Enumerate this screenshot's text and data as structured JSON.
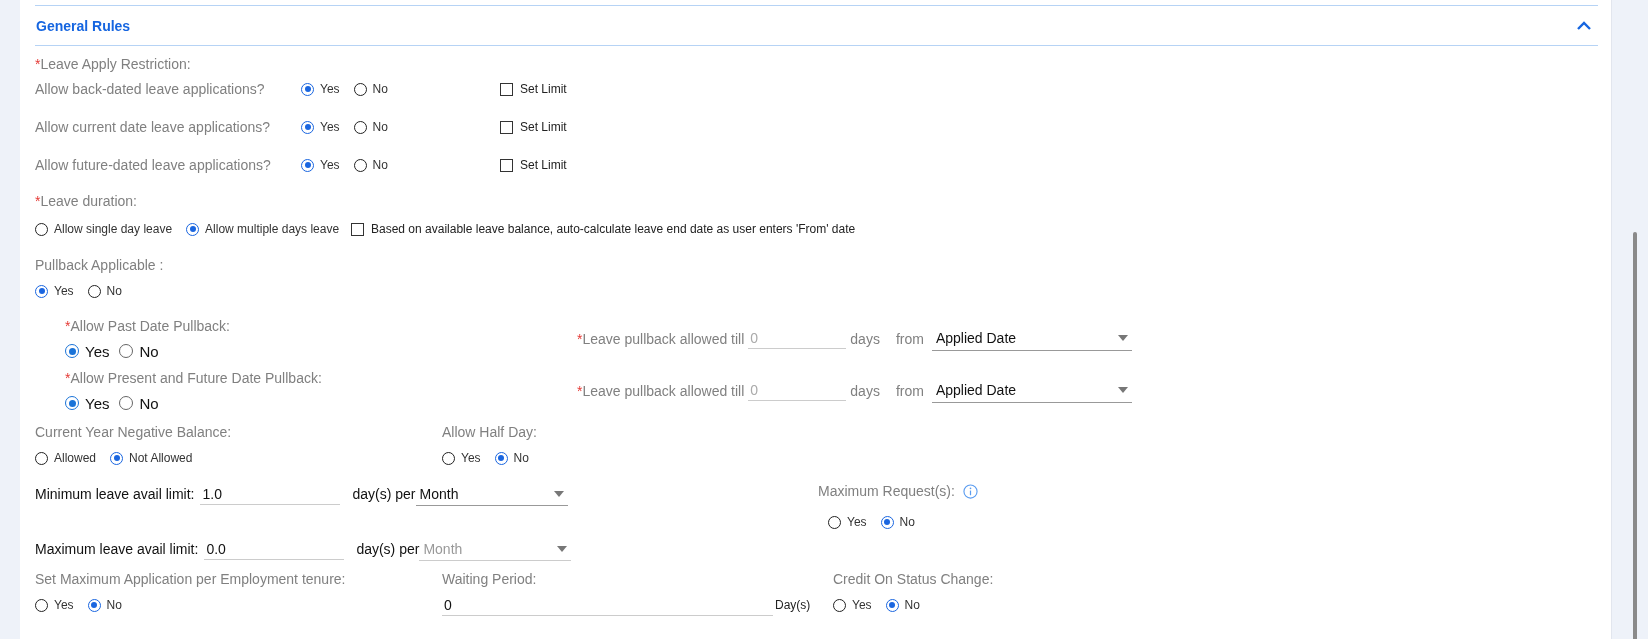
{
  "section": {
    "title": "General Rules",
    "expanded": true
  },
  "leave_apply_restriction": {
    "required_mark": "*",
    "label": "Leave Apply Restriction:",
    "rows": [
      {
        "label": "Allow back-dated leave applications?",
        "options": [
          {
            "label": "Yes",
            "selected": true
          },
          {
            "label": "No",
            "selected": false
          }
        ],
        "set_limit": {
          "label": "Set Limit",
          "checked": false
        }
      },
      {
        "label": "Allow current date leave applications?",
        "options": [
          {
            "label": "Yes",
            "selected": true
          },
          {
            "label": "No",
            "selected": false
          }
        ],
        "set_limit": {
          "label": "Set Limit",
          "checked": false
        }
      },
      {
        "label": "Allow future-dated leave applications?",
        "options": [
          {
            "label": "Yes",
            "selected": true
          },
          {
            "label": "No",
            "selected": false
          }
        ],
        "set_limit": {
          "label": "Set Limit",
          "checked": false
        }
      }
    ]
  },
  "leave_duration": {
    "required_mark": "*",
    "label": "Leave duration:",
    "options": [
      {
        "label": "Allow single day leave",
        "selected": false
      },
      {
        "label": "Allow multiple days leave",
        "selected": true
      }
    ],
    "auto_calculate": {
      "label": "Based on available leave balance, auto-calculate leave end date as user enters 'From' date",
      "checked": false
    }
  },
  "pullback": {
    "label": "Pullback Applicable :",
    "options": [
      {
        "label": "Yes",
        "selected": true
      },
      {
        "label": "No",
        "selected": false
      }
    ],
    "rules": [
      {
        "required_mark": "*",
        "label": "Allow Past Date Pullback:",
        "options": [
          {
            "label": "Yes",
            "selected": true
          },
          {
            "label": "No",
            "selected": false
          }
        ],
        "till_required_mark": "*",
        "till_label": "Leave pullback allowed till",
        "till_placeholder": "0",
        "days_label": "days",
        "from_label": "from",
        "from_value": "Applied Date"
      },
      {
        "required_mark": "*",
        "label": "Allow Present and Future Date Pullback:",
        "options": [
          {
            "label": "Yes",
            "selected": true
          },
          {
            "label": "No",
            "selected": false
          }
        ],
        "till_required_mark": "*",
        "till_label": "Leave pullback allowed till",
        "till_placeholder": "0",
        "days_label": "days",
        "from_label": "from",
        "from_value": "Applied Date"
      }
    ]
  },
  "negative_balance": {
    "label": "Current Year Negative Balance:",
    "options": [
      {
        "label": "Allowed",
        "selected": false
      },
      {
        "label": "Not Allowed",
        "selected": true
      }
    ]
  },
  "half_day": {
    "label": "Allow Half Day:",
    "options": [
      {
        "label": "Yes",
        "selected": false
      },
      {
        "label": "No",
        "selected": true
      }
    ]
  },
  "min_limit": {
    "label": "Minimum leave avail limit:",
    "value": "1.0",
    "per_label": "day(s) per",
    "period": "Month",
    "disabled": false
  },
  "max_limit": {
    "label": "Maximum leave avail limit:",
    "value": "0.0",
    "per_label": "day(s) per",
    "period": "Month",
    "disabled": true
  },
  "max_requests": {
    "label": "Maximum Request(s):",
    "options": [
      {
        "label": "Yes",
        "selected": false
      },
      {
        "label": "No",
        "selected": true
      }
    ]
  },
  "tenure": {
    "label": "Set Maximum Application per Employment tenure:",
    "options": [
      {
        "label": "Yes",
        "selected": false
      },
      {
        "label": "No",
        "selected": true
      }
    ]
  },
  "waiting_period": {
    "label": "Waiting Period:",
    "value": "0",
    "unit": "Day(s)"
  },
  "credit_status_change": {
    "label": "Credit On Status Change:",
    "options": [
      {
        "label": "Yes",
        "selected": false
      },
      {
        "label": "No",
        "selected": true
      }
    ]
  }
}
